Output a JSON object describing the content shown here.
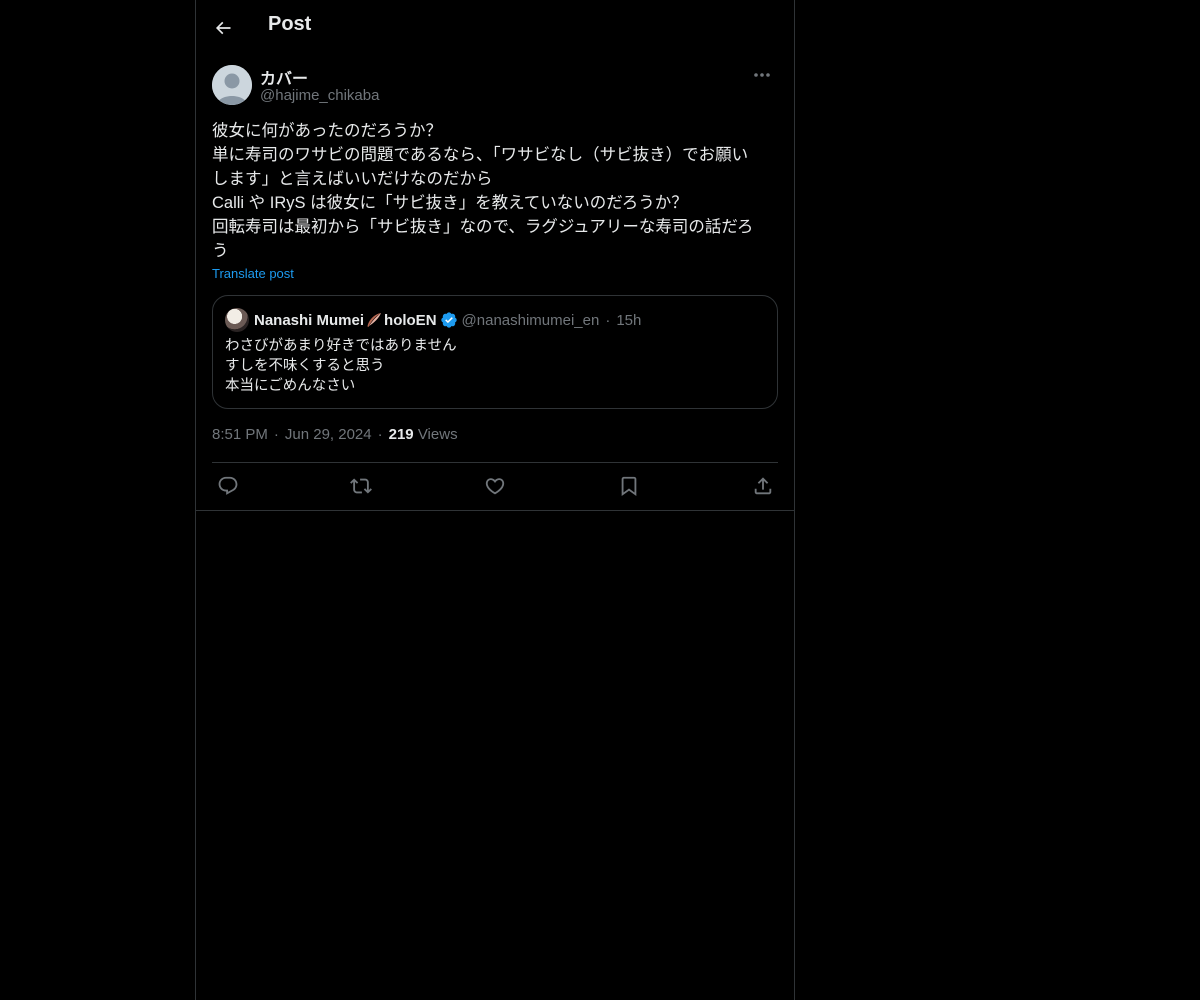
{
  "header": {
    "back_icon": "arrow-left-icon",
    "title": "Post"
  },
  "post": {
    "author": {
      "display_name": "カバー",
      "handle": "@hajime_chikaba",
      "avatar_icon": "default-avatar"
    },
    "more_icon": "ellipsis-icon",
    "text_lines": [
      "彼女に何があったのだろうか？",
      "単に寿司のワサビの問題であるなら、「ワサビなし（サビ抜き）でお願い",
      "します」と言えばいいだけなのだから",
      "Calli や IRyS は彼女に「サビ抜き」を教えていないのだろうか？",
      "回転寿司は最初から「サビ抜き」なので、ラグジュアリーな寿司の話だろ",
      "う"
    ],
    "translate_label": "Translate post",
    "quote": {
      "name": "Nanashi Mumei",
      "name_suffix": "holoEN",
      "handle": "@nanashimumei_en",
      "separator": "·",
      "time": "15h",
      "lines": [
        "わさびがあまり好きではありません",
        "すしを不味くすると思う",
        "本当にごめんなさい"
      ]
    },
    "meta": {
      "time": "8:51 PM",
      "separator": "·",
      "date": "Jun 29, 2024",
      "views_count": "219",
      "views_label": "Views"
    },
    "actions": [
      {
        "icon": "reply-icon"
      },
      {
        "icon": "repost-icon"
      },
      {
        "icon": "like-icon"
      },
      {
        "icon": "bookmark-icon"
      },
      {
        "icon": "share-icon"
      }
    ]
  },
  "colors": {
    "background": "#000000",
    "text": "#e7e9ea",
    "muted": "#71767b",
    "border": "#2f3336",
    "accent": "#1d9bf0"
  }
}
